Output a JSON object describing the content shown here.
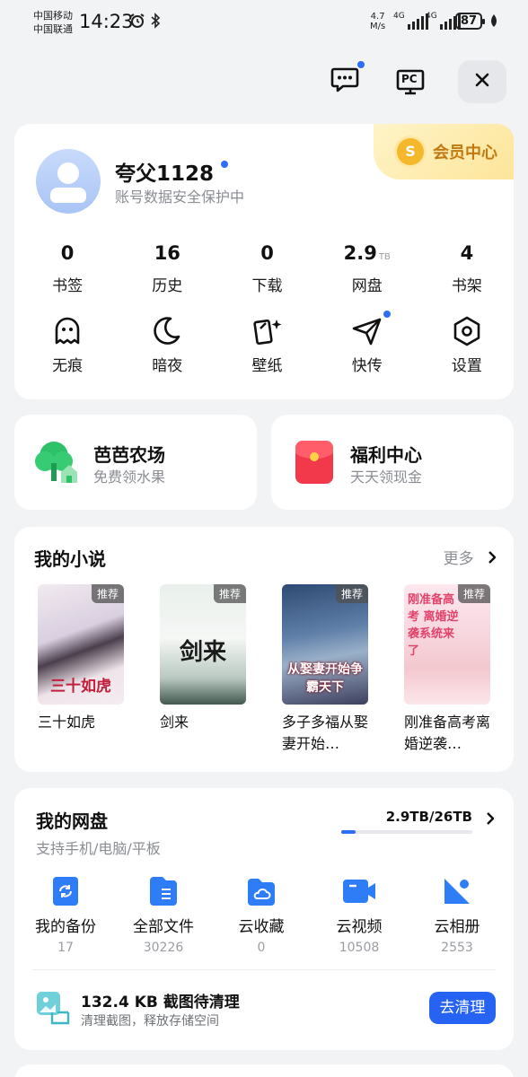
{
  "status_bar": {
    "carrier_1": "中国移动",
    "carrier_2": "中国联通",
    "time": "14:23",
    "net_speed_value": "4.7",
    "net_speed_unit": "M/s",
    "signal_1": "4G",
    "signal_2": "4G",
    "battery": "87"
  },
  "toolbar": {
    "message_icon": "message-icon",
    "pc_icon": "pc-icon",
    "pc_label": "PC",
    "close_icon": "close-icon"
  },
  "profile": {
    "username": "夸父1128",
    "subtitle": "账号数据安全保护中",
    "vip_coin": "S",
    "vip_label": "会员中心",
    "stats": [
      {
        "value": "0",
        "unit": "",
        "label": "书签"
      },
      {
        "value": "16",
        "unit": "",
        "label": "历史"
      },
      {
        "value": "0",
        "unit": "",
        "label": "下载"
      },
      {
        "value": "2.9",
        "unit": "TB",
        "label": "网盘"
      },
      {
        "value": "4",
        "unit": "",
        "label": "书架"
      }
    ],
    "tools": [
      {
        "label": "无痕",
        "icon": "ghost-icon"
      },
      {
        "label": "暗夜",
        "icon": "moon-icon"
      },
      {
        "label": "壁纸",
        "icon": "wallpaper-icon"
      },
      {
        "label": "快传",
        "icon": "paper-plane-icon"
      },
      {
        "label": "设置",
        "icon": "settings-icon"
      }
    ]
  },
  "promos": [
    {
      "title": "芭芭农场",
      "subtitle": "免费领水果",
      "icon": "farm-tree-icon"
    },
    {
      "title": "福利中心",
      "subtitle": "天天领现金",
      "icon": "red-envelope-icon"
    }
  ],
  "novels": {
    "title": "我的小说",
    "more": "更多",
    "tag": "推荐",
    "books": [
      {
        "title": "三十如虎",
        "cover_text": "三十如虎"
      },
      {
        "title": "剑来",
        "cover_text": "剑来"
      },
      {
        "title": "多子多福从娶妻开始…",
        "cover_text": "从娶妻开始争霸天下"
      },
      {
        "title": "刚准备高考离婚逆袭…",
        "cover_text": "刚准备高考 离婚逆袭系统来了"
      }
    ]
  },
  "netdisk": {
    "title": "我的网盘",
    "subtitle": "支持手机/电脑/平板",
    "usage": "2.9TB/26TB",
    "usage_fraction": 0.11,
    "categories": [
      {
        "label": "我的备份",
        "count": "17",
        "icon": "backup-icon"
      },
      {
        "label": "全部文件",
        "count": "30226",
        "icon": "file-icon"
      },
      {
        "label": "云收藏",
        "count": "0",
        "icon": "cloud-folder-icon"
      },
      {
        "label": "云视频",
        "count": "10508",
        "icon": "video-icon"
      },
      {
        "label": "云相册",
        "count": "2553",
        "icon": "photo-icon"
      }
    ],
    "cleanup_title": "132.4 KB 截图待清理",
    "cleanup_subtitle": "清理截图，释放存储空间",
    "cleanup_button": "去清理"
  },
  "colors": {
    "accent": "#2763f2",
    "vip_gold": "#c27a10",
    "background": "#f2f3f5"
  }
}
